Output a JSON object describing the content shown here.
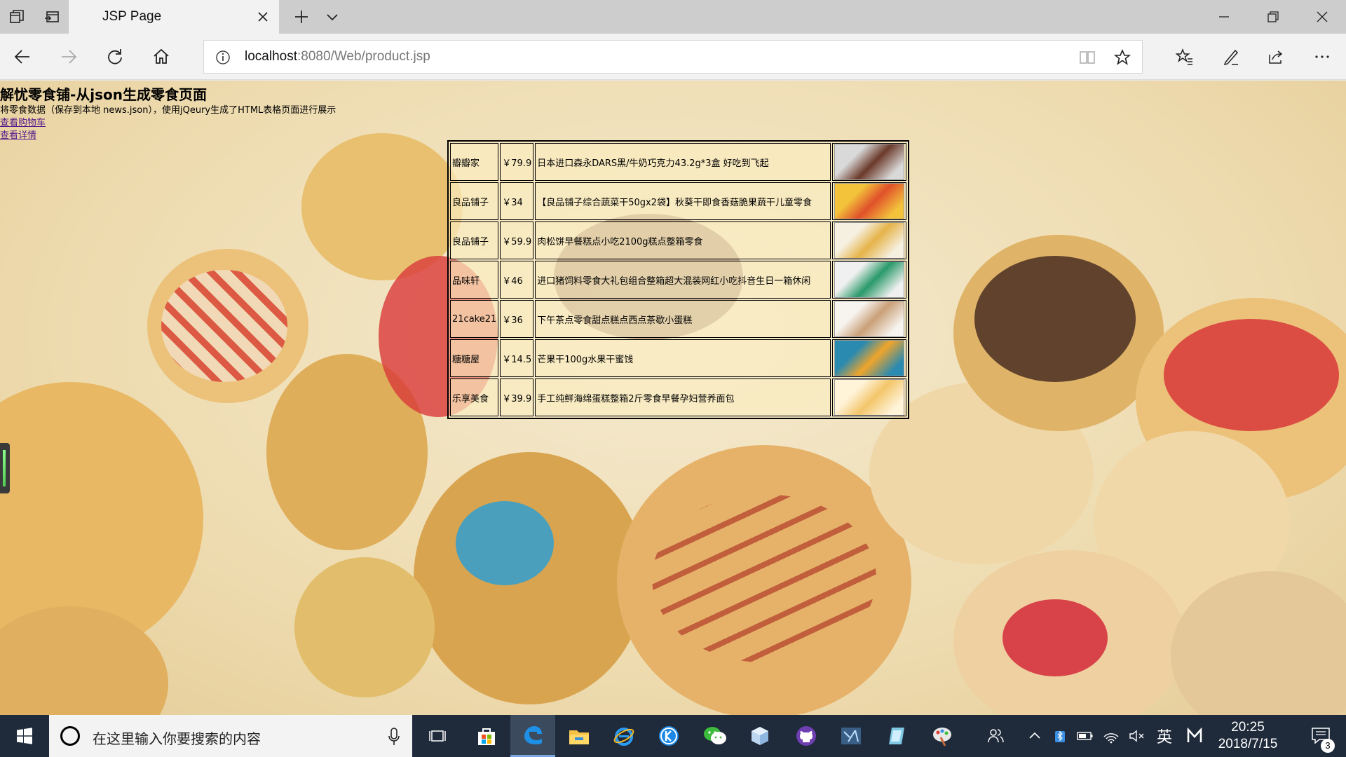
{
  "browser": {
    "tab_title": "JSP Page",
    "url_host": "localhost",
    "url_rest": ":8080/Web/product.jsp"
  },
  "page": {
    "title": "解忧零食铺-从json生成零食页面",
    "description": "将零食数据（保存到本地 news.json），使用jQeury生成了HTML表格页面进行展示",
    "links": {
      "cart": "查看购物车",
      "details": "查看详情"
    },
    "products": [
      {
        "shop": "瓣瓣家",
        "price": "￥79.9",
        "name": "日本进口森永DARS黑/牛奶巧克力43.2g*3盒 好吃到飞起",
        "thumb_colors": [
          "#6b3a2a",
          "#d9d9d9"
        ]
      },
      {
        "shop": "良品铺子",
        "price": "￥34",
        "name": "【良品铺子综合蔬菜干50gx2袋】秋葵干即食香菇脆果蔬干儿童零食",
        "thumb_colors": [
          "#e0502a",
          "#f3c33b"
        ]
      },
      {
        "shop": "良品铺子",
        "price": "￥59.9",
        "name": "肉松饼早餐糕点小吃2100g糕点整箱零食",
        "thumb_colors": [
          "#e6b34a",
          "#f5f0e0"
        ]
      },
      {
        "shop": "品味轩",
        "price": "￥46",
        "name": "进口猪饲料零食大礼包组合整箱超大混装网红小吃抖音生日一箱休闲",
        "thumb_colors": [
          "#2a9a6a",
          "#f0f0f0"
        ]
      },
      {
        "shop": "21cake21",
        "price": "￥36",
        "name": "下午茶点零食甜点糕点西点茶歇小蛋糕",
        "thumb_colors": [
          "#c9a078",
          "#f7f4ef"
        ]
      },
      {
        "shop": "糖糖屋",
        "price": "￥14.5",
        "name": "芒果干100g水果干蜜饯",
        "thumb_colors": [
          "#f0a52a",
          "#2a8ab0"
        ]
      },
      {
        "shop": "乐享美食",
        "price": "￥39.9",
        "name": "手工纯鲜海绵蛋糕整箱2斤零食早餐孕妇营养面包",
        "thumb_colors": [
          "#f3c66a",
          "#fff3d8"
        ]
      }
    ]
  },
  "taskbar": {
    "search_placeholder": "在这里输入你要搜索的内容",
    "ime": "英",
    "time": "20:25",
    "date": "2018/7/15",
    "notification_count": "3"
  },
  "colors": {
    "tabstrip": "#cdcdcd",
    "toolbar": "#f2f2f2",
    "taskbar": "#1f2a3a",
    "link_visited": "#551a8b"
  }
}
